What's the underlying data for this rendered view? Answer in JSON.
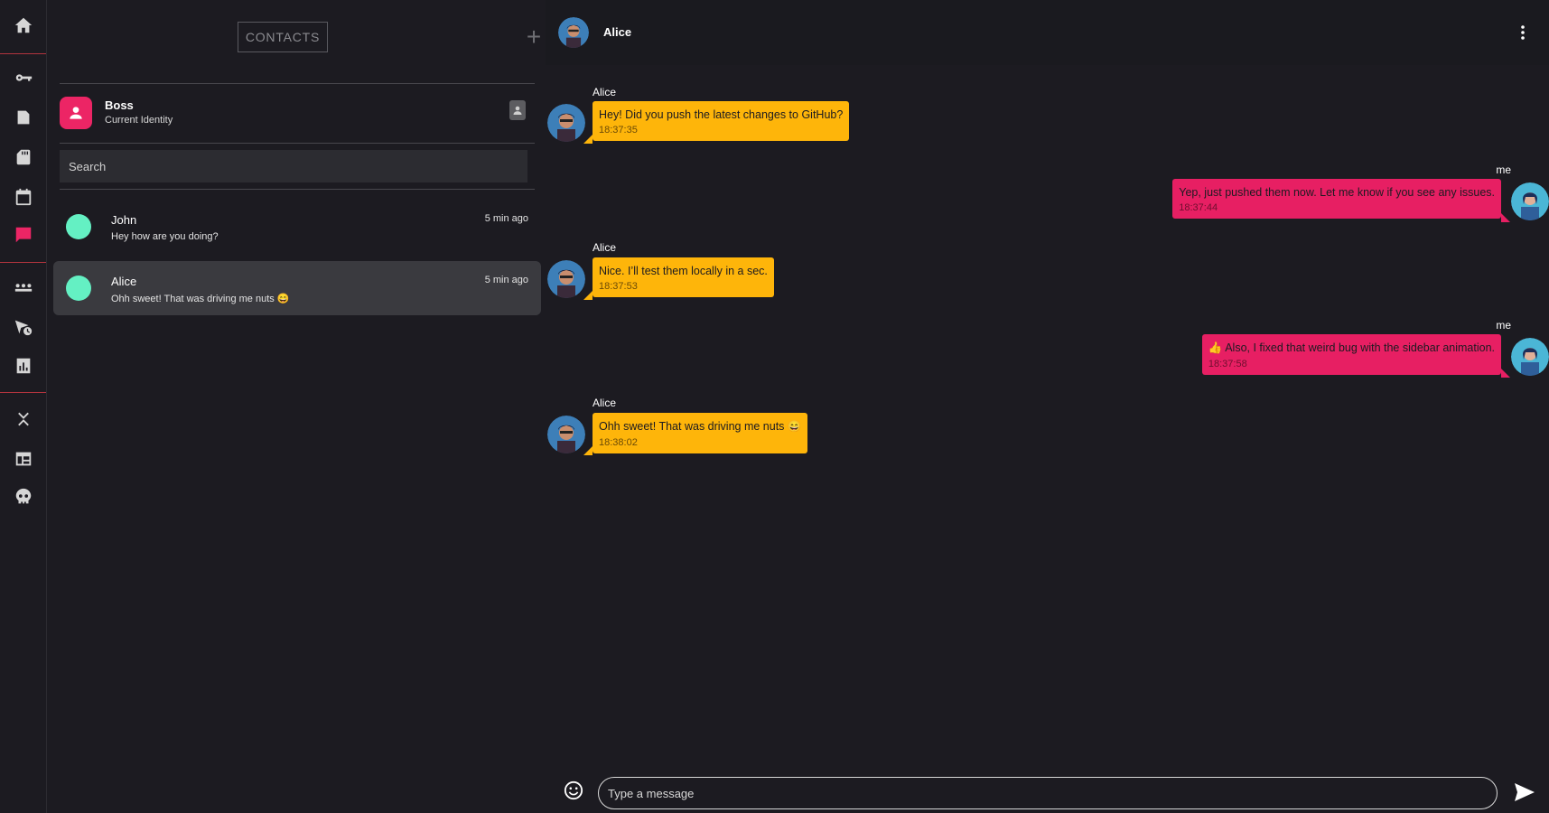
{
  "rail": {
    "items": [
      {
        "icon": "home-icon"
      },
      {
        "icon": "key-icon"
      },
      {
        "icon": "document-icon"
      },
      {
        "icon": "sd-card-icon"
      },
      {
        "icon": "calendar-icon"
      },
      {
        "icon": "chat-icon",
        "active": true
      },
      {
        "icon": "users-icon"
      },
      {
        "icon": "send-clock-icon"
      },
      {
        "icon": "analytics-icon"
      },
      {
        "icon": "collapse-icon"
      },
      {
        "icon": "table-icon"
      },
      {
        "icon": "skull-icon"
      }
    ],
    "accent_color": "#ec2565"
  },
  "contacts_panel": {
    "contacts_button": "CONTACTS",
    "add_button": "+",
    "identity": {
      "name": "Boss",
      "subtitle": "Current Identity"
    },
    "search_placeholder": "Search",
    "contacts": [
      {
        "name": "John",
        "preview": "Hey how are you doing?",
        "time": "5 min ago",
        "selected": false
      },
      {
        "name": "Alice",
        "preview": "Ohh sweet! That was driving me nuts 😄",
        "time": "5 min ago",
        "selected": true
      }
    ]
  },
  "chat": {
    "header": {
      "name": "Alice"
    },
    "messages": [
      {
        "sender": "Alice",
        "direction": "in",
        "text": "Hey! Did you push the latest changes to GitHub?",
        "time": "18:37:35"
      },
      {
        "sender": "me",
        "direction": "out",
        "text": "Yep, just pushed them now. Let me know if you see any issues.",
        "time": "18:37:44"
      },
      {
        "sender": "Alice",
        "direction": "in",
        "text": "Nice. I’ll test them locally in a sec.",
        "time": "18:37:53"
      },
      {
        "sender": "me",
        "direction": "out",
        "text": "👍 Also, I fixed that weird bug with the sidebar animation.",
        "time": "18:37:58"
      },
      {
        "sender": "Alice",
        "direction": "in",
        "text": "Ohh sweet! That was driving me nuts 😄",
        "time": "18:38:02"
      }
    ],
    "composer": {
      "placeholder": "Type a message"
    },
    "colors": {
      "incoming": "#feb50a",
      "outgoing": "#e71f63",
      "online_dot": "#64f0c3"
    }
  }
}
